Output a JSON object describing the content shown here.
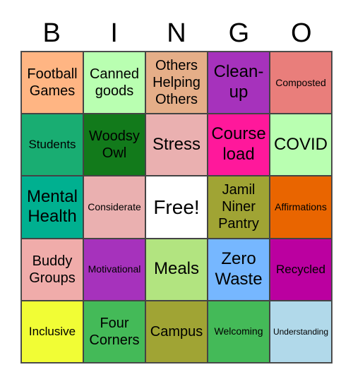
{
  "header": [
    "B",
    "I",
    "N",
    "G",
    "O"
  ],
  "cells": [
    {
      "text": "Football Games",
      "color": "#ffb583",
      "size": "m"
    },
    {
      "text": "Canned goods",
      "color": "#b9ffb1",
      "size": "m"
    },
    {
      "text": "Others Helping Others",
      "color": "#e5ae88",
      "size": "m"
    },
    {
      "text": "Clean-up",
      "color": "#a632bc",
      "size": "l"
    },
    {
      "text": "Composted",
      "color": "#e97e7b",
      "size": "xs"
    },
    {
      "text": "Students",
      "color": "#19ad72",
      "size": "s"
    },
    {
      "text": "Woodsy Owl",
      "color": "#127a1b",
      "size": "m"
    },
    {
      "text": "Stress",
      "color": "#eab0b0",
      "size": "l"
    },
    {
      "text": "Course load",
      "color": "#ff189b",
      "size": "l"
    },
    {
      "text": "COVID",
      "color": "#b9ffb1",
      "size": "l"
    },
    {
      "text": "Mental Health",
      "color": "#00b090",
      "size": "l"
    },
    {
      "text": "Considerate",
      "color": "#eab0b0",
      "size": "xs"
    },
    {
      "text": "Free!",
      "color": "#ffffff",
      "size": "xl"
    },
    {
      "text": "Jamil Niner Pantry",
      "color": "#a0a434",
      "size": "m"
    },
    {
      "text": "Affirmations",
      "color": "#e96500",
      "size": "xs"
    },
    {
      "text": "Buddy Groups",
      "color": "#f0acaa",
      "size": "m"
    },
    {
      "text": "Motivational",
      "color": "#a632bc",
      "size": "xs"
    },
    {
      "text": "Meals",
      "color": "#b2e480",
      "size": "l"
    },
    {
      "text": "Zero Waste",
      "color": "#76b7ff",
      "size": "l"
    },
    {
      "text": "Recycled",
      "color": "#bb00a0",
      "size": "s"
    },
    {
      "text": "Inclusive",
      "color": "#f1fd35",
      "size": "s"
    },
    {
      "text": "Four Corners",
      "color": "#44ba58",
      "size": "m"
    },
    {
      "text": "Campus",
      "color": "#a0a434",
      "size": "m"
    },
    {
      "text": "Welcoming",
      "color": "#44ba58",
      "size": "xs"
    },
    {
      "text": "Understanding",
      "color": "#b1d9ea",
      "size": "xxs"
    }
  ]
}
